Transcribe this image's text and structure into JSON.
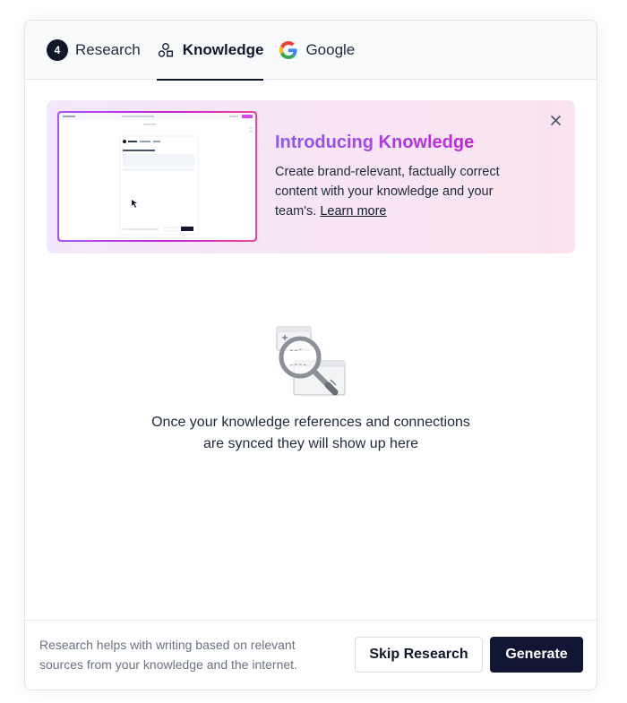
{
  "tabs": [
    {
      "label": "Research",
      "badge": "4",
      "active": false
    },
    {
      "label": "Knowledge",
      "icon": "shapes-icon",
      "active": true
    },
    {
      "label": "Google",
      "icon": "google-icon",
      "active": false
    }
  ],
  "promo": {
    "title": "Introducing Knowledge",
    "body": "Create brand-relevant, factually correct content with your knowledge and your team's.",
    "link": "Learn more",
    "close_icon": "close-icon"
  },
  "empty_state": {
    "icon": "magnifier-icon",
    "line1": "Once your knowledge references and connections",
    "line2": "are synced they will show up here"
  },
  "footer": {
    "note_line1": "Research helps with writing based on relevant",
    "note_line2": "sources from your knowledge and the internet.",
    "skip_label": "Skip Research",
    "generate_label": "Generate"
  },
  "colors": {
    "primary": "#111634",
    "accent_from": "#8b5cf6",
    "accent_to": "#c026d3",
    "promo_bg": "#f5e6f5"
  }
}
